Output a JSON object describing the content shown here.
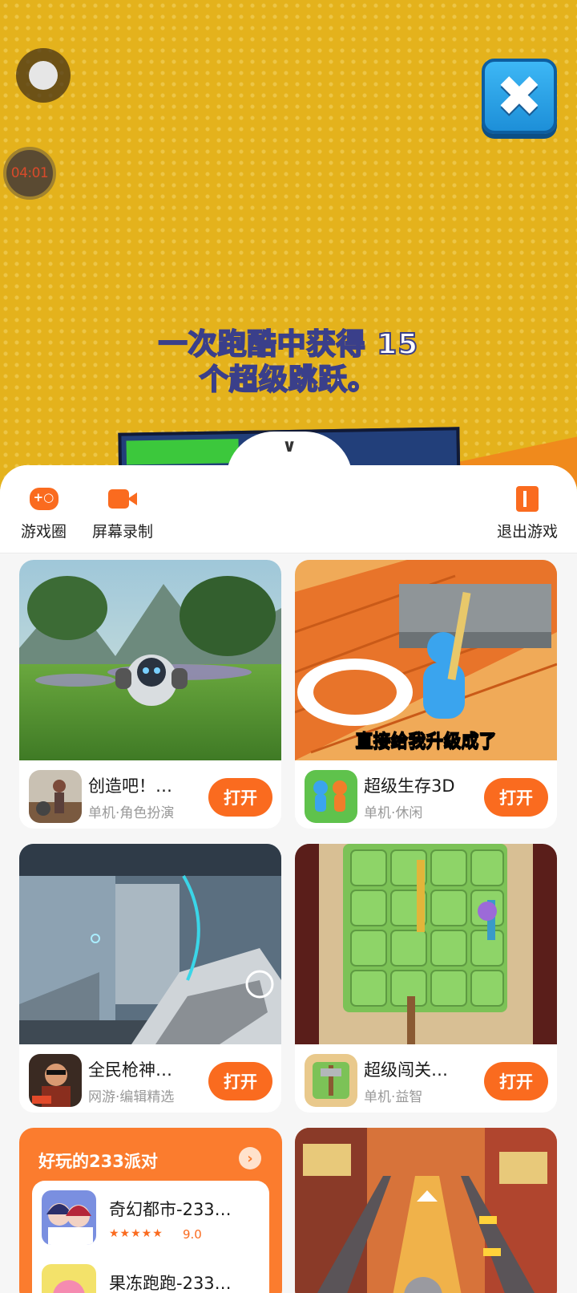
{
  "game": {
    "timer": "04:01",
    "mission_line1": "一次跑酷中获得 15",
    "mission_line2": "个超级跳跃。",
    "close_icon": "close-icon",
    "collapse_icon": "chevron-down-icon"
  },
  "toolbar": {
    "items": [
      {
        "label": "游戏圈",
        "icon": "gamepad-icon"
      },
      {
        "label": "屏幕录制",
        "icon": "video-camera-icon"
      },
      {
        "label": "退出游戏",
        "icon": "exit-door-icon"
      }
    ]
  },
  "cards": [
    {
      "title": "创造吧！…",
      "sub": "单机·角色扮演",
      "button": "打开"
    },
    {
      "title": "超级生存3D",
      "sub": "单机·休闲",
      "button": "打开",
      "shot_caption": "直接给我升级成了"
    },
    {
      "title": "全民枪神…",
      "sub": "网游·编辑精选",
      "button": "打开"
    },
    {
      "title": "超级闯关…",
      "sub": "单机·益智",
      "button": "打开"
    }
  ],
  "party": {
    "title": "好玩的233派对",
    "arrow": "›",
    "items": [
      {
        "name": "奇幻都市-233…",
        "stars": "★★★★★",
        "rating": "9.0"
      },
      {
        "name": "果冻跑跑-233…"
      }
    ]
  },
  "colors": {
    "accent": "#fa6b1f",
    "game_bg": "#e4b21c",
    "close_button": "#2aa6ea"
  }
}
